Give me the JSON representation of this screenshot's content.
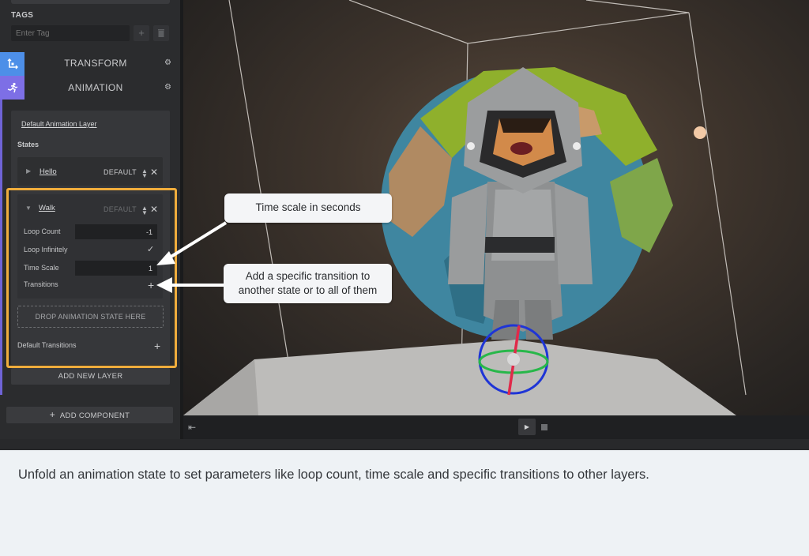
{
  "panel": {
    "tags_label": "TAGS",
    "tag_placeholder": "Enter Tag",
    "tag_add_icon": "plus-icon",
    "tag_delete_icon": "trash-icon",
    "sections": {
      "transform": "TRANSFORM",
      "animation": "ANIMATION"
    },
    "tab_colors": {
      "transform": "#4d8fe8",
      "animation": "#7d6fe6"
    }
  },
  "animation": {
    "layer_name": "Default Animation Layer",
    "states_label": "States",
    "states": [
      {
        "name": "Hello",
        "badge": "DEFAULT",
        "expanded": false
      },
      {
        "name": "Walk",
        "badge": "DEFAULT",
        "expanded": true
      }
    ],
    "walk_fields": {
      "loop_count_label": "Loop Count",
      "loop_count_value": "-1",
      "loop_infinitely_label": "Loop Infinitely",
      "loop_infinitely_checked": true,
      "time_scale_label": "Time Scale",
      "time_scale_value": "1",
      "transitions_label": "Transitions"
    },
    "drop_zone": "DROP ANIMATION STATE HERE",
    "default_transitions": "Default Transitions",
    "add_layer": "ADD NEW LAYER",
    "add_component": "ADD COMPONENT"
  },
  "callouts": {
    "time_scale": "Time scale in seconds",
    "transition_line1": "Add a specific transition to",
    "transition_line2": "another state or to all of them"
  },
  "caption": "Unfold an animation state to set parameters like loop count, time scale and specific transitions to other layers.",
  "colors": {
    "highlight": "#f0ad3c",
    "accent": "#6f63d6"
  }
}
